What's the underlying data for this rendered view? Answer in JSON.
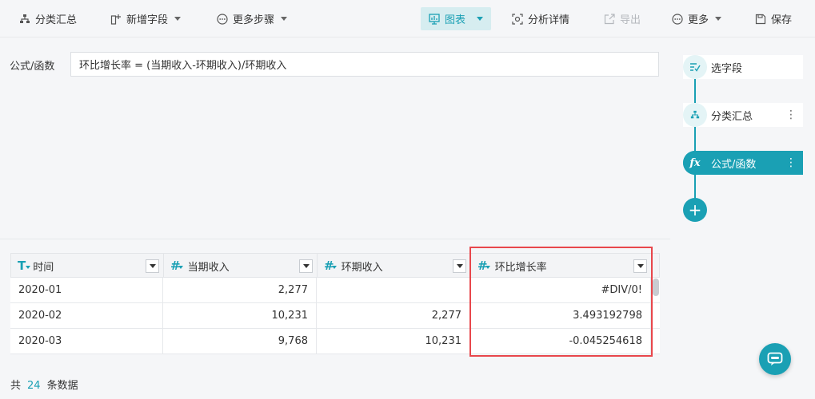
{
  "toolbar": {
    "group_summary": "分类汇总",
    "add_field": "新增字段",
    "more_steps": "更多步骤",
    "chart": "图表",
    "analysis_detail": "分析详情",
    "export": "导出",
    "more": "更多",
    "save": "保存"
  },
  "formula": {
    "label": "公式/函数",
    "value": "环比增长率 = (当期收入-环期收入)/环期收入"
  },
  "table": {
    "columns": [
      {
        "type": "T",
        "label": "时间"
      },
      {
        "type": "#",
        "label": "当期收入"
      },
      {
        "type": "#",
        "label": "环期收入"
      },
      {
        "type": "#",
        "label": "环比增长率"
      }
    ],
    "rows": [
      [
        "2020-01",
        "2,277",
        "",
        "#DIV/0!"
      ],
      [
        "2020-02",
        "10,231",
        "2,277",
        "3.493192798"
      ],
      [
        "2020-03",
        "9,768",
        "10,231",
        "-0.045254618"
      ]
    ]
  },
  "footer": {
    "prefix": "共",
    "count": "24",
    "suffix": "条数据"
  },
  "steps": {
    "items": [
      {
        "label": "选字段",
        "icon": "select-field-icon"
      },
      {
        "label": "分类汇总",
        "icon": "group-summary-icon"
      },
      {
        "label": "公式/函数",
        "icon": "fx-icon",
        "active": true
      }
    ],
    "add": "+",
    "more": "⋮"
  },
  "colors": {
    "accent": "#1aa0b4",
    "highlight": "#e8474c"
  }
}
